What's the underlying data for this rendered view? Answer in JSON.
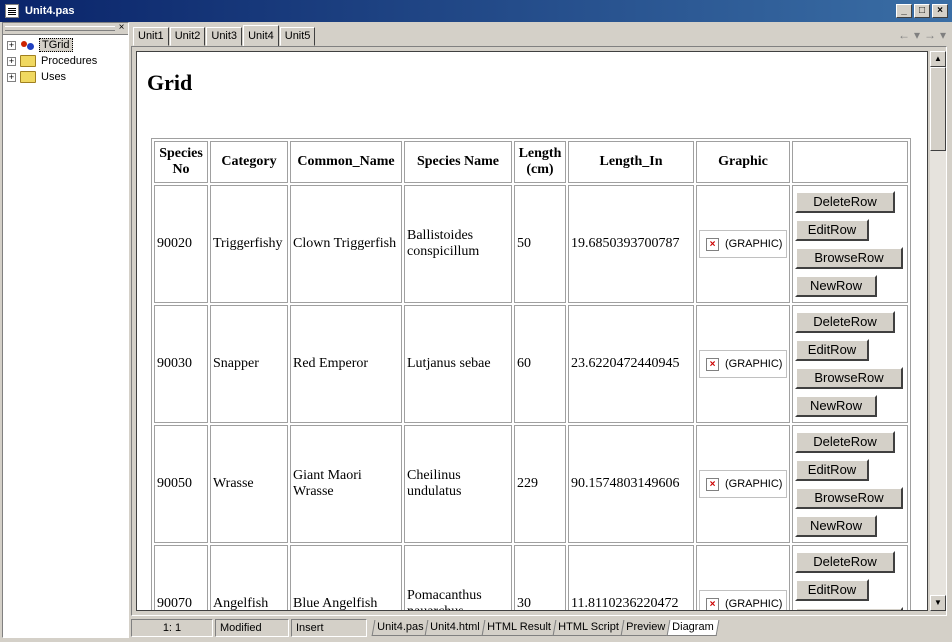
{
  "window": {
    "title": "Unit4.pas",
    "icon": "document-icon"
  },
  "tree": {
    "items": [
      {
        "label": "TGrid",
        "icon": "class-icon",
        "selected": true
      },
      {
        "label": "Procedures",
        "icon": "folder-icon",
        "selected": false
      },
      {
        "label": "Uses",
        "icon": "folder-icon",
        "selected": false
      }
    ]
  },
  "tabs": [
    "Unit1",
    "Unit2",
    "Unit3",
    "Unit4",
    "Unit5"
  ],
  "active_tab": "Unit4",
  "page": {
    "heading": "Grid",
    "columns": [
      "Species No",
      "Category",
      "Common_Name",
      "Species Name",
      "Length (cm)",
      "Length_In",
      "Graphic",
      ""
    ],
    "graphic_label": "(GRAPHIC)",
    "buttons": {
      "delete": "DeleteRow",
      "edit": "EditRow",
      "browse": "BrowseRow",
      "new": "NewRow"
    },
    "rows": [
      {
        "species_no": "90020",
        "category": "Triggerfishy",
        "common_name": "Clown Triggerfish",
        "species_name": "Ballistoides conspicillum",
        "length_cm": "50",
        "length_in": "19.6850393700787"
      },
      {
        "species_no": "90030",
        "category": "Snapper",
        "common_name": "Red Emperor",
        "species_name": "Lutjanus sebae",
        "length_cm": "60",
        "length_in": "23.6220472440945"
      },
      {
        "species_no": "90050",
        "category": "Wrasse",
        "common_name": "Giant Maori Wrasse",
        "species_name": "Cheilinus undulatus",
        "length_cm": "229",
        "length_in": "90.1574803149606"
      },
      {
        "species_no": "90070",
        "category": "Angelfish",
        "common_name": "Blue Angelfish",
        "species_name": "Pomacanthus nauarchus",
        "length_cm": "30",
        "length_in": "11.8110236220472"
      }
    ]
  },
  "status": {
    "position": "1:  1",
    "modified": "Modified",
    "mode": "Insert"
  },
  "bottom_tabs": [
    "Unit4.pas",
    "Unit4.html",
    "HTML Result",
    "HTML Script",
    "Preview",
    "Diagram"
  ],
  "active_bottom_tab": "Diagram"
}
